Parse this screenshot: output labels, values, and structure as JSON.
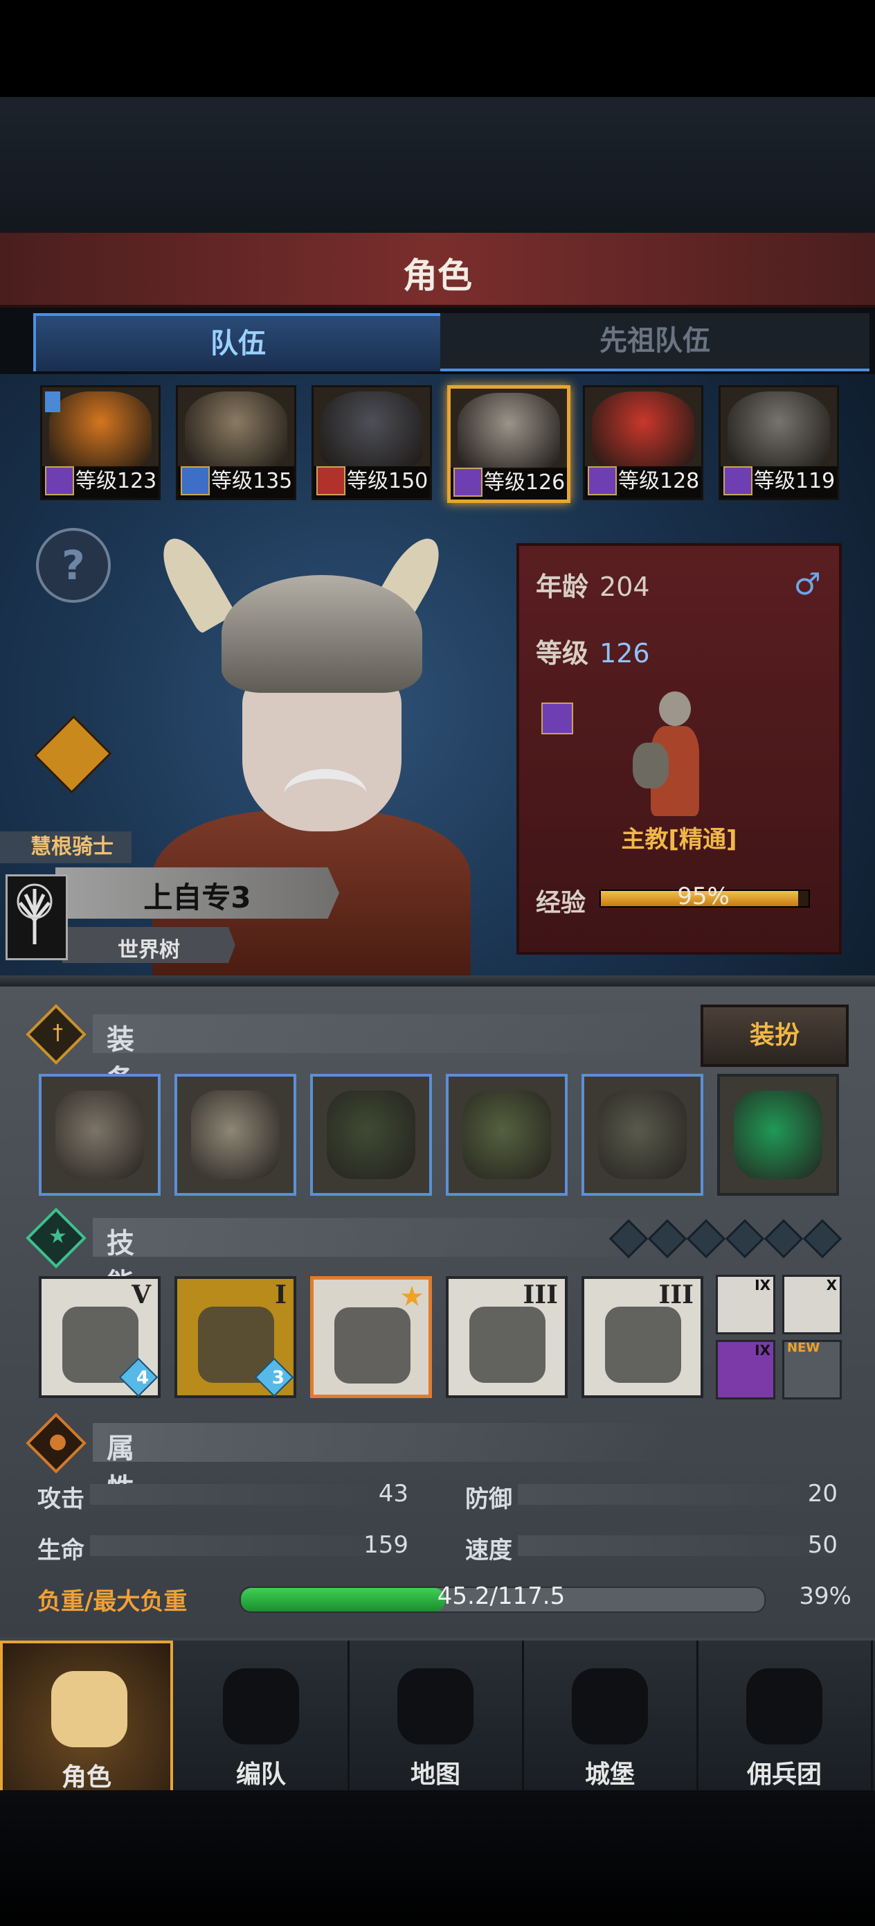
{
  "header": {
    "title": "角色"
  },
  "tabs": [
    {
      "label": "队伍",
      "active": true
    },
    {
      "label": "先祖队伍",
      "active": false
    }
  ],
  "roster": [
    {
      "level_text": "等级123",
      "class_color": "#6e3fb3",
      "face_color": "#d4761f",
      "flag": true
    },
    {
      "level_text": "等级135",
      "class_color": "#3e6fc7",
      "face_color": "#8a7a62",
      "flag": false
    },
    {
      "level_text": "等级150",
      "class_color": "#b0322a",
      "face_color": "#4e5058",
      "flag": false
    },
    {
      "level_text": "等级126",
      "class_color": "#6e3fb3",
      "face_color": "#9a948a",
      "flag": false,
      "selected": true
    },
    {
      "level_text": "等级128",
      "class_color": "#6e3fb3",
      "face_color": "#c9372c",
      "flag": false
    },
    {
      "level_text": "等级119",
      "class_color": "#6e3fb3",
      "face_color": "#77746e",
      "flag": false
    }
  ],
  "hero": {
    "help": "?",
    "title_tag": "慧根骑士",
    "name": "上自专3",
    "guild": "世界树",
    "age_label": "年龄",
    "age": "204",
    "gender": "♂",
    "level_label": "等级",
    "level": "126",
    "class_name": "主教[精通]",
    "xp_label": "经验",
    "xp_percent": "95%",
    "xp_fraction": 0.95
  },
  "equipment": {
    "title": "装备",
    "dress_button": "装扮",
    "items": [
      {
        "name": "skull-mace",
        "color": "#7d7467",
        "rare": true
      },
      {
        "name": "round-shield",
        "color": "#8e8676",
        "rare": true
      },
      {
        "name": "hood",
        "color": "#3f4a34",
        "rare": true
      },
      {
        "name": "fur-armor",
        "color": "#55603f",
        "rare": true
      },
      {
        "name": "boots",
        "color": "#5a5a4c",
        "rare": true
      },
      {
        "name": "green-crystal",
        "color": "#1f9a56",
        "rare": false
      }
    ]
  },
  "skills": {
    "title": "技能",
    "slots": 6,
    "items": [
      {
        "rank": "V",
        "gem": "4",
        "style": "plain"
      },
      {
        "rank": "I",
        "gem": "3",
        "style": "gold"
      },
      {
        "rank": "",
        "gem": "",
        "style": "selected",
        "starred": true
      },
      {
        "rank": "III",
        "gem": "",
        "style": "plain"
      },
      {
        "rank": "III",
        "gem": "",
        "style": "plain"
      }
    ],
    "passives": [
      {
        "rank": "IX",
        "style": "plain"
      },
      {
        "rank": "X",
        "style": "plain"
      },
      {
        "rank": "IX",
        "style": "purple"
      },
      {
        "rank": "",
        "style": "empty",
        "badge": "NEW"
      }
    ]
  },
  "attributes": {
    "title": "属性",
    "attack_label": "攻击",
    "attack": "43",
    "defense_label": "防御",
    "defense": "20",
    "hp_label": "生命",
    "hp": "159",
    "speed_label": "速度",
    "speed": "50",
    "load_label": "负重/最大负重",
    "load_text": "45.2/117.5",
    "load_percent": "39%",
    "load_fraction": 0.39
  },
  "nav": [
    {
      "label": "角色",
      "active": true
    },
    {
      "label": "编队",
      "active": false
    },
    {
      "label": "地图",
      "active": false
    },
    {
      "label": "城堡",
      "active": false
    },
    {
      "label": "佣兵团",
      "active": false
    }
  ]
}
